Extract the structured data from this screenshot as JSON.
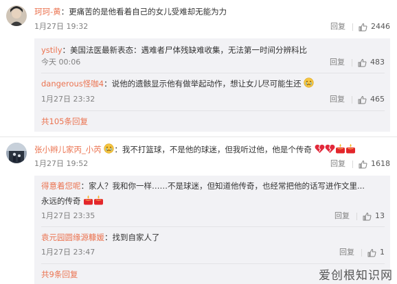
{
  "comments": [
    {
      "username": "珂珂-黄",
      "text": "更痛苦的是他看着自己的女儿受难却无能为力",
      "time": "1月27日 19:32",
      "reply_label": "回复",
      "likes": "2446",
      "replies": [
        {
          "username": "ystily",
          "text": "美国法医最新表态：遇难者尸体残缺难收集，无法第一时间分辨科比",
          "time": "今天 00:06",
          "reply_label": "回复",
          "likes": "483"
        },
        {
          "username": "dangerous怪咖4",
          "text": "说他的遗骸显示他有做举起动作，想让女儿尽可能生还",
          "time": "1月27日 23:32",
          "reply_label": "回复",
          "likes": "465"
        }
      ],
      "more_replies": "共105条回复"
    },
    {
      "username": "张小辫儿家丙_小芮",
      "text": "我不打篮球，不是他的球迷，但我听过他，他是个传奇",
      "time": "1月27日 19:52",
      "reply_label": "回复",
      "likes": "1618",
      "replies": [
        {
          "username": "得意着您呢",
          "text": "家人？我和你一样……不是球迷，但知道他传奇，也经常把他的话写进作文里...",
          "text2": "永远的传奇",
          "time": "1月27日 23:35",
          "reply_label": "回复",
          "likes": "13"
        },
        {
          "username": "袁元园圆缘源糠媛",
          "text": "找到自家人了",
          "time": "1月27日 23:47",
          "reply_label": "回复",
          "likes": "1"
        }
      ],
      "more_replies": "共9条回复"
    }
  ],
  "icons": {
    "like": "thumbs-up-icon",
    "crying_emoji": "crying-face-emoji-icon",
    "heart_emoji": "broken-heart-emoji-icon",
    "candle_emoji": "candle-emoji-icon"
  },
  "watermark": "爱创根知识网",
  "colors": {
    "username": "#eb7350",
    "sub_bg": "#f2f2f5",
    "meta": "#808080"
  }
}
